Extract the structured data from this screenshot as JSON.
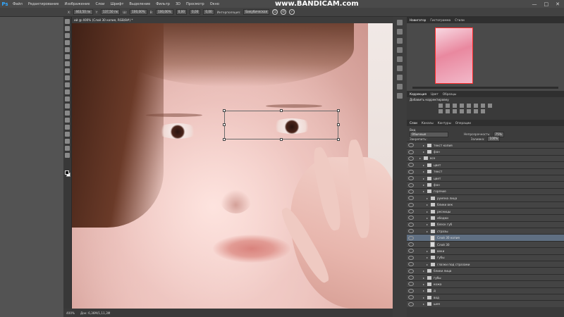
{
  "menubar": {
    "logo": "Ps",
    "items": [
      "Файл",
      "Редактирование",
      "Изображение",
      "Слои",
      "Шрифт",
      "Выделение",
      "Фильтр",
      "3D",
      "Просмотр",
      "Окно"
    ],
    "watermark": "www.BANDICAM.com",
    "win_buttons": [
      "—",
      "□",
      "✕"
    ]
  },
  "options": {
    "x_value": "463,50 пк",
    "y_value": "137,50 пк",
    "w_value": "100,00%",
    "h_value": "100,00%",
    "angle_value": "0,00",
    "h_skew": "0,00",
    "v_skew": "0,00",
    "interp_label": "Интерполяция:",
    "interp_value": "Бикубическая"
  },
  "document": {
    "tab_title": "ий @ 400% (Слой 30 копия, RGB/8#) *",
    "zoom": "400%",
    "doc_size": "Док: 6,36M/1,11,3M"
  },
  "panels": {
    "top_tabs": [
      "Навигатор",
      "Гистограмма",
      "Стили"
    ],
    "adj_tabs": [
      "Коррекция",
      "Цвет",
      "Образцы"
    ],
    "adj_title": "Добавить корректировку",
    "layer_tabs": [
      "Слои",
      "Каналы",
      "Контуры",
      "Операции"
    ],
    "filter_label": "Вид",
    "blend_mode": "Обычные",
    "opacity_label": "Непрозрачность:",
    "opacity_value": "75%",
    "lock_label": "Закрепить:",
    "fill_label": "Заливка:",
    "fill_value": "100%",
    "layers": [
      {
        "name": "текст копия",
        "type": "folder",
        "indent": 2,
        "selected": false
      },
      {
        "name": "фон",
        "type": "folder",
        "indent": 2,
        "selected": false
      },
      {
        "name": "все",
        "type": "folder",
        "indent": 1,
        "selected": false
      },
      {
        "name": "цвет",
        "type": "folder",
        "indent": 2,
        "selected": false
      },
      {
        "name": "текст",
        "type": "folder",
        "indent": 2,
        "selected": false
      },
      {
        "name": "цвет",
        "type": "folder",
        "indent": 2,
        "selected": false
      },
      {
        "name": "фон",
        "type": "folder",
        "indent": 2,
        "selected": false
      },
      {
        "name": "горячие",
        "type": "folder",
        "indent": 2,
        "selected": false
      },
      {
        "name": "румяна лица",
        "type": "folder",
        "indent": 3,
        "selected": false
      },
      {
        "name": "блики век",
        "type": "folder",
        "indent": 3,
        "selected": false
      },
      {
        "name": "ресницы",
        "type": "folder",
        "indent": 3,
        "selected": false
      },
      {
        "name": "ободки",
        "type": "folder",
        "indent": 3,
        "selected": false
      },
      {
        "name": "блеск губ",
        "type": "folder",
        "indent": 3,
        "selected": false
      },
      {
        "name": "стразы",
        "type": "folder",
        "indent": 3,
        "selected": false
      },
      {
        "name": "Слой 30 копия",
        "type": "layer",
        "indent": 4,
        "selected": true
      },
      {
        "name": "Слой 30",
        "type": "layer",
        "indent": 4,
        "selected": false
      },
      {
        "name": "веки",
        "type": "folder",
        "indent": 3,
        "selected": false
      },
      {
        "name": "губы",
        "type": "folder",
        "indent": 3,
        "selected": false
      },
      {
        "name": "глазки под стразами",
        "type": "folder",
        "indent": 3,
        "selected": false
      },
      {
        "name": "блики лица",
        "type": "folder",
        "indent": 2,
        "selected": false
      },
      {
        "name": "губы",
        "type": "folder",
        "indent": 2,
        "selected": false
      },
      {
        "name": "кожа",
        "type": "folder",
        "indent": 2,
        "selected": false
      },
      {
        "name": "д",
        "type": "folder",
        "indent": 2,
        "selected": false
      },
      {
        "name": "вод",
        "type": "folder",
        "indent": 2,
        "selected": false
      },
      {
        "name": "шея",
        "type": "folder",
        "indent": 2,
        "selected": false
      }
    ]
  }
}
